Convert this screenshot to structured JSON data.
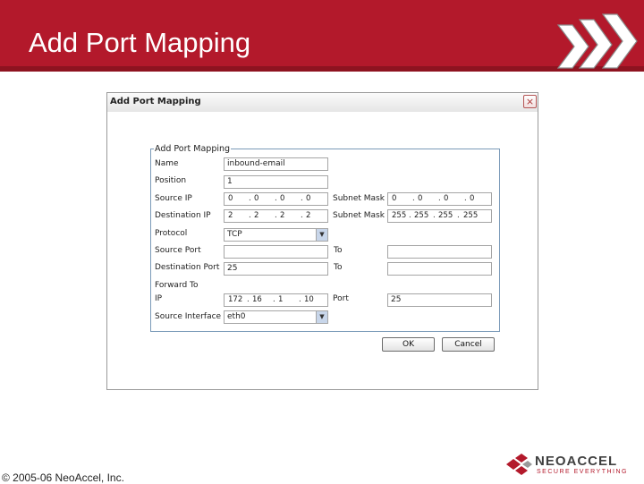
{
  "slide": {
    "title": "Add Port Mapping",
    "copyright": "© 2005-06 NeoAccel, Inc."
  },
  "logo": {
    "name": "NEOACCEL",
    "tagline": "SECURE EVERYTHING"
  },
  "dialog": {
    "title": "Add Port Mapping",
    "close_glyph": "×",
    "group_label": "Add Port Mapping",
    "labels": {
      "name": "Name",
      "position": "Position",
      "source_ip": "Source IP",
      "destination_ip": "Destination IP",
      "protocol": "Protocol",
      "source_port": "Source Port",
      "destination_port": "Destination Port",
      "forward_to": "Forward To",
      "ip": "IP",
      "source_interface": "Source Interface",
      "subnet_mask_1": "Subnet Mask",
      "subnet_mask_2": "Subnet Mask",
      "to_1": "To",
      "to_2": "To",
      "port": "Port"
    },
    "values": {
      "name": "inbound-email",
      "position": "1",
      "source_ip": [
        "0",
        "0",
        "0",
        "0"
      ],
      "source_mask": [
        "0",
        "0",
        "0",
        "0"
      ],
      "destination_ip": [
        "2",
        "2",
        "2",
        "2"
      ],
      "destination_mask": [
        "255",
        "255",
        "255",
        "255"
      ],
      "protocol": "TCP",
      "source_port": "",
      "source_port_to": "",
      "destination_port": "25",
      "destination_port_to": "",
      "forward_ip": [
        "172",
        "16",
        "1",
        "10"
      ],
      "forward_port": "25",
      "source_interface": "eth0"
    },
    "buttons": {
      "ok": "OK",
      "cancel": "Cancel"
    }
  }
}
